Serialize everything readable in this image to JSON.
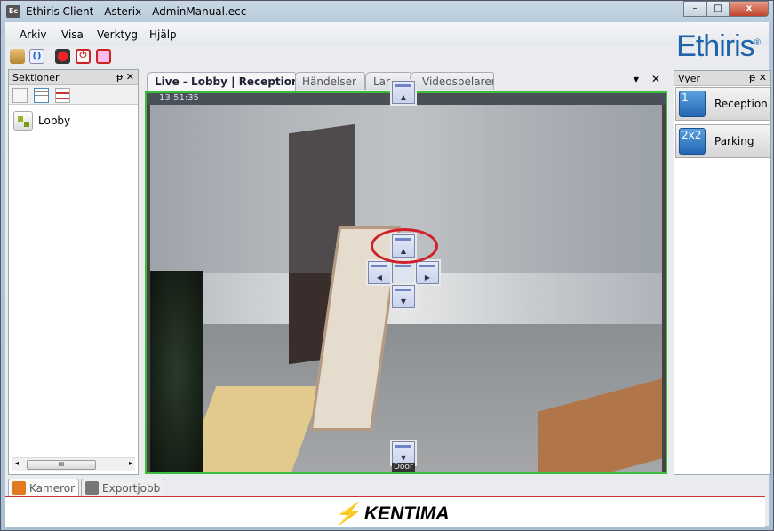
{
  "window": {
    "title": "Ethiris Client - Asterix - AdminManual.ecc",
    "app_icon": "Ec",
    "minimize": "–",
    "maximize": "□",
    "close": "x"
  },
  "menu": [
    "Arkiv",
    "Visa",
    "Verktyg",
    "Hjälp"
  ],
  "toolbar": {
    "icons": [
      "folder-open-icon",
      "refresh-icon",
      "record-icon",
      "power-icon",
      "alarm-icon"
    ]
  },
  "brand": {
    "name": "Ethiris",
    "mark": "®",
    "footer": "KENTIMA"
  },
  "sektioner": {
    "title": "Sektioner",
    "items": [
      {
        "label": "Lobby"
      }
    ],
    "scroll_thumb": "III"
  },
  "tabs": [
    {
      "label": "Live - Lobby | Reception",
      "active": true
    },
    {
      "label": "Händelser"
    },
    {
      "label": "Larm"
    },
    {
      "label": "Videospelaren"
    }
  ],
  "video": {
    "timestamp": "13:51:35",
    "camera_label": "Door",
    "border_color": "#3bbd3b"
  },
  "vyer": {
    "title": "Vyer",
    "items": [
      {
        "icon": "1",
        "label": "Reception"
      },
      {
        "icon": "2x2",
        "label": "Parking"
      }
    ]
  },
  "bottom_tabs": [
    {
      "label": "Kameror"
    },
    {
      "label": "Exportjobb"
    }
  ],
  "panel_controls": {
    "pin": "ᵖ",
    "close": "✕",
    "dropdown": "▾"
  }
}
